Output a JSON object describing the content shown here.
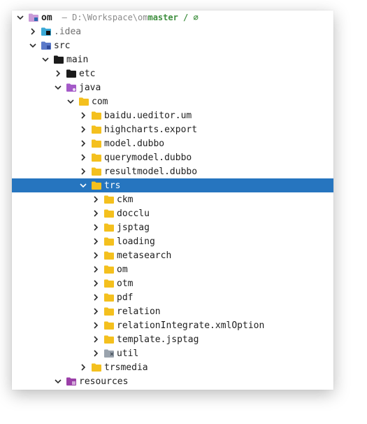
{
  "header": {
    "root_label": "om",
    "path_text": "– D:\\Workspace\\om",
    "branch_text": "master / ∅"
  },
  "tree": [
    {
      "label": "om",
      "depth": 0,
      "expand": "expanded",
      "icon": "module-folder-icon",
      "selected": false
    },
    {
      "label": ".idea",
      "depth": 1,
      "expand": "collapsed",
      "icon": "idea-folder-icon",
      "selected": false
    },
    {
      "label": "src",
      "depth": 1,
      "expand": "expanded",
      "icon": "source-folder-icon",
      "selected": false
    },
    {
      "label": "main",
      "depth": 2,
      "expand": "expanded",
      "icon": "black-folder-icon",
      "selected": false
    },
    {
      "label": "etc",
      "depth": 3,
      "expand": "collapsed",
      "icon": "black-folder-icon",
      "selected": false
    },
    {
      "label": "java",
      "depth": 3,
      "expand": "expanded",
      "icon": "java-folder-icon",
      "selected": false
    },
    {
      "label": "com",
      "depth": 4,
      "expand": "expanded",
      "icon": "package-folder-icon",
      "selected": false
    },
    {
      "label": "baidu.ueditor.um",
      "depth": 5,
      "expand": "collapsed",
      "icon": "package-folder-icon",
      "selected": false
    },
    {
      "label": "highcharts.export",
      "depth": 5,
      "expand": "collapsed",
      "icon": "package-folder-icon",
      "selected": false
    },
    {
      "label": "model.dubbo",
      "depth": 5,
      "expand": "collapsed",
      "icon": "package-folder-icon",
      "selected": false
    },
    {
      "label": "querymodel.dubbo",
      "depth": 5,
      "expand": "collapsed",
      "icon": "package-folder-icon",
      "selected": false
    },
    {
      "label": "resultmodel.dubbo",
      "depth": 5,
      "expand": "collapsed",
      "icon": "package-folder-icon",
      "selected": false
    },
    {
      "label": "trs",
      "depth": 5,
      "expand": "expanded",
      "icon": "package-folder-icon",
      "selected": true
    },
    {
      "label": "ckm",
      "depth": 6,
      "expand": "collapsed",
      "icon": "package-folder-icon",
      "selected": false
    },
    {
      "label": "docclu",
      "depth": 6,
      "expand": "collapsed",
      "icon": "package-folder-icon",
      "selected": false
    },
    {
      "label": "jsptag",
      "depth": 6,
      "expand": "collapsed",
      "icon": "package-folder-icon",
      "selected": false
    },
    {
      "label": "loading",
      "depth": 6,
      "expand": "collapsed",
      "icon": "package-folder-icon",
      "selected": false
    },
    {
      "label": "metasearch",
      "depth": 6,
      "expand": "collapsed",
      "icon": "package-folder-icon",
      "selected": false
    },
    {
      "label": "om",
      "depth": 6,
      "expand": "collapsed",
      "icon": "package-folder-icon",
      "selected": false
    },
    {
      "label": "otm",
      "depth": 6,
      "expand": "collapsed",
      "icon": "package-folder-icon",
      "selected": false
    },
    {
      "label": "pdf",
      "depth": 6,
      "expand": "collapsed",
      "icon": "package-folder-icon",
      "selected": false
    },
    {
      "label": "relation",
      "depth": 6,
      "expand": "collapsed",
      "icon": "package-folder-icon",
      "selected": false
    },
    {
      "label": "relationIntegrate.xmlOption",
      "depth": 6,
      "expand": "collapsed",
      "icon": "package-folder-icon",
      "selected": false
    },
    {
      "label": "template.jsptag",
      "depth": 6,
      "expand": "collapsed",
      "icon": "package-folder-icon",
      "selected": false
    },
    {
      "label": "util",
      "depth": 6,
      "expand": "collapsed",
      "icon": "util-package-icon",
      "selected": false
    },
    {
      "label": "trsmedia",
      "depth": 5,
      "expand": "collapsed",
      "icon": "package-folder-icon",
      "selected": false
    },
    {
      "label": "resources",
      "depth": 3,
      "expand": "expanded",
      "icon": "resources-folder-icon",
      "selected": false
    }
  ],
  "colors": {
    "selection": "#2675bf",
    "package_folder": "#f4c01e",
    "java_folder": "#a45ac8",
    "resources_folder": "#9b3fa8",
    "source_folder": "#5a79c9",
    "idea_folder": "#3ba9d6",
    "module_folder": "#c99bd8",
    "branch": "#3f8f3f"
  }
}
